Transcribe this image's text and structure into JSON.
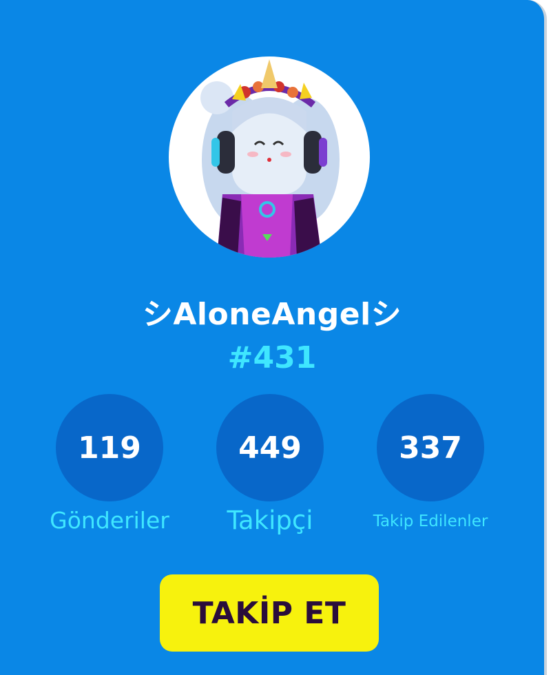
{
  "profile": {
    "username": "シAloneAngelシ",
    "user_id": "#431",
    "avatar_icon": "avatar-unicorn-headphones"
  },
  "stats": [
    {
      "value": "119",
      "label": "Gönderiler"
    },
    {
      "value": "449",
      "label": "Takipçi"
    },
    {
      "value": "337",
      "label": "Takip Edilenler"
    }
  ],
  "actions": {
    "follow_label": "TAKİP ET"
  },
  "colors": {
    "background": "#0a87e6",
    "stat_circle": "#0867c9",
    "accent_text": "#3fe6ff",
    "follow_button": "#f7f20d",
    "follow_text": "#2a0d3b"
  }
}
